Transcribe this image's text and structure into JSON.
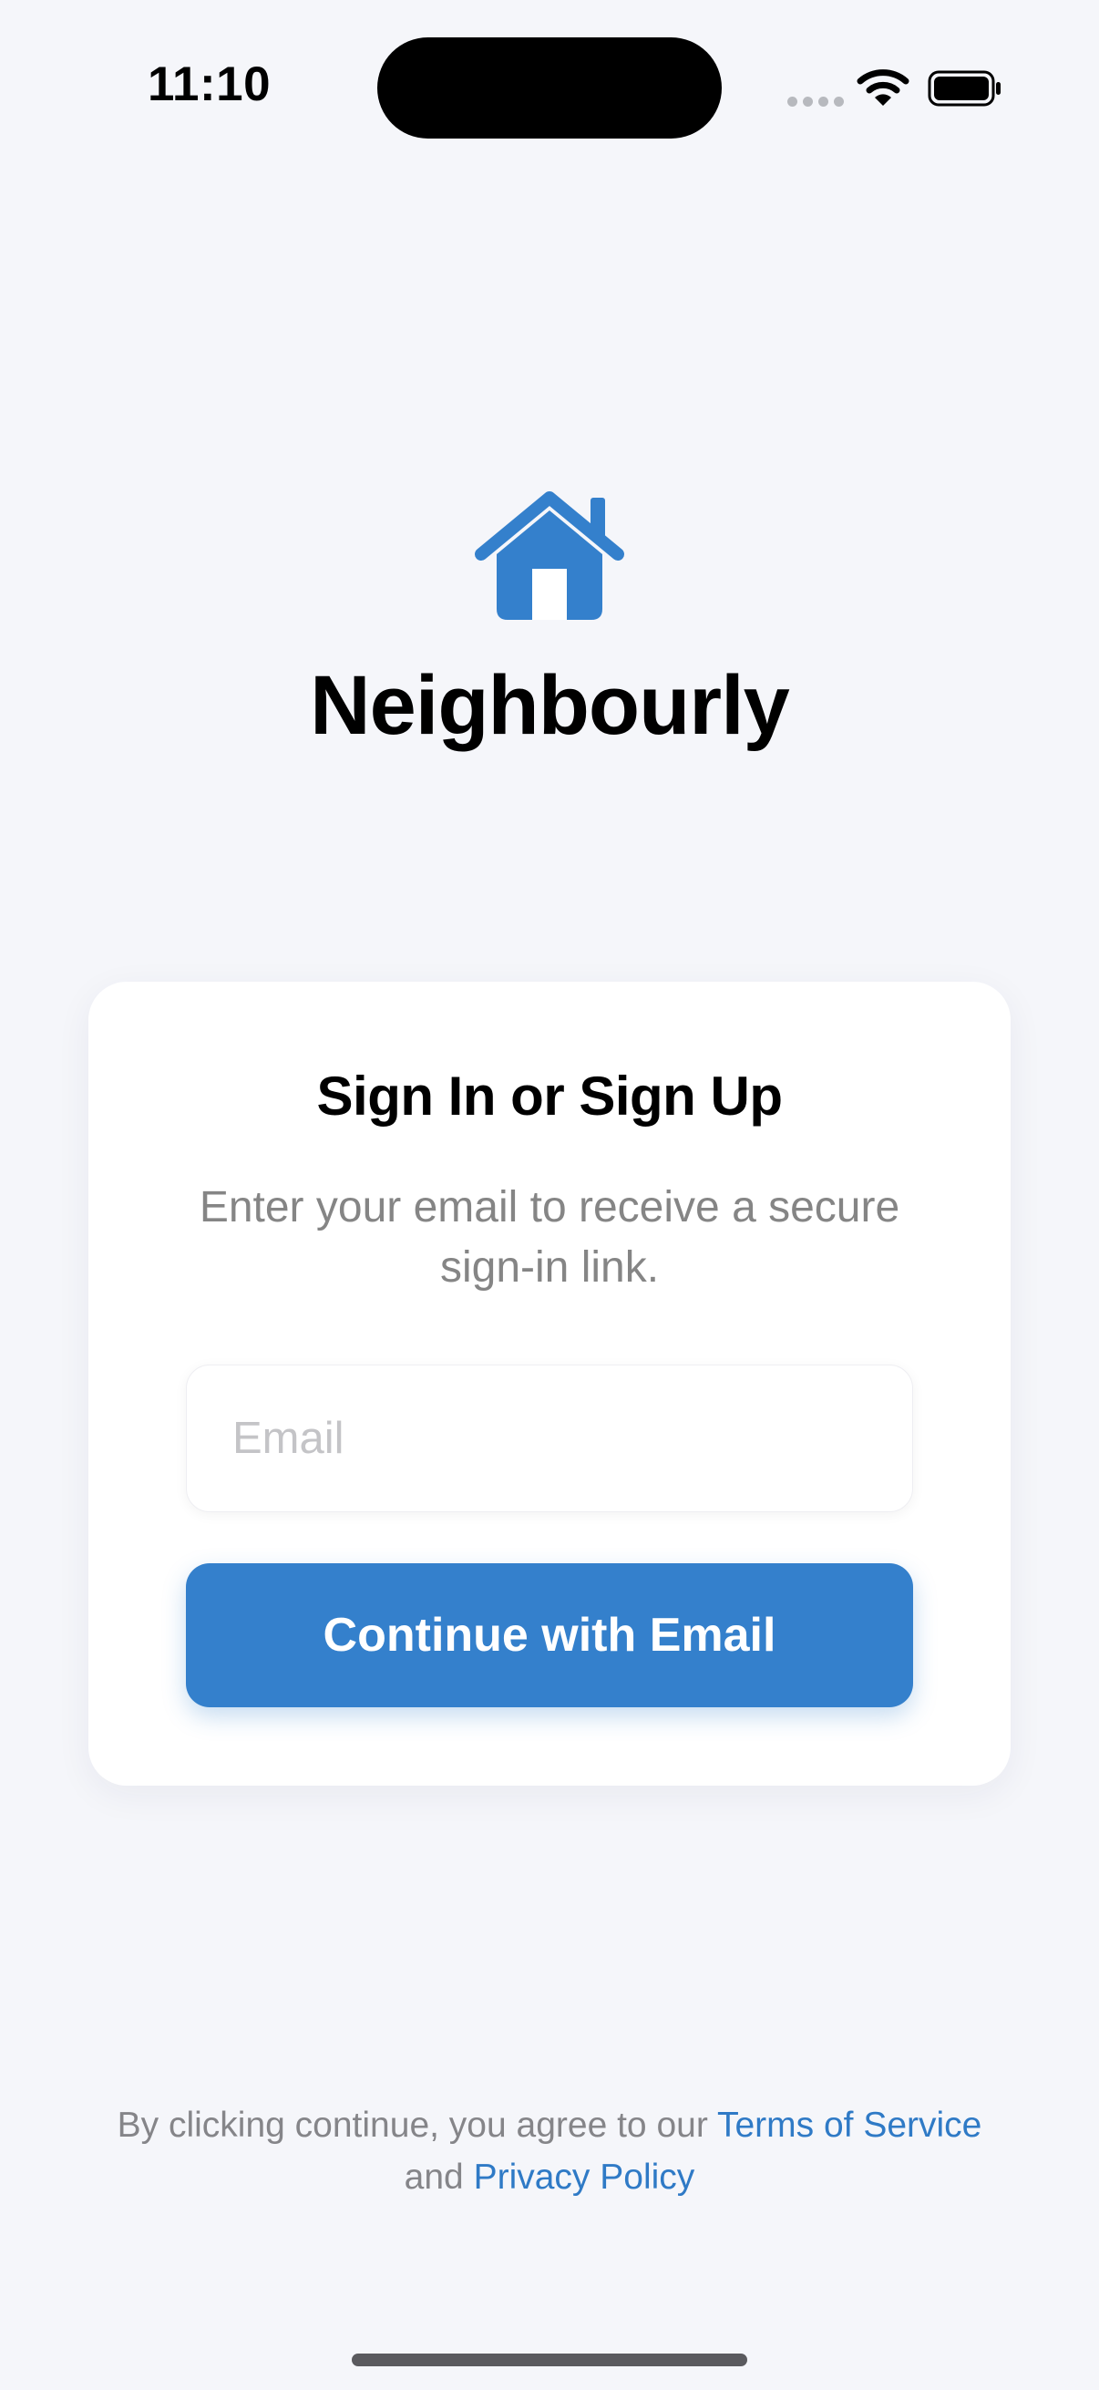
{
  "status_bar": {
    "time": "11:10",
    "icons": [
      "signal-dots-icon",
      "wifi-icon",
      "battery-icon"
    ]
  },
  "brand": {
    "icon": "house-icon",
    "name": "Neighbourly",
    "color": "#3480cc"
  },
  "auth_card": {
    "title": "Sign In or Sign Up",
    "subtitle": "Enter your email to receive a secure sign-in link.",
    "email_input": {
      "placeholder": "Email",
      "value": ""
    },
    "continue_button_label": "Continue with Email"
  },
  "footer": {
    "prefix": "By clicking continue, you agree to our ",
    "terms_link": "Terms of Service",
    "conjunction": " and ",
    "privacy_link": "Privacy Policy",
    "link_color": "#2f7ac6"
  }
}
